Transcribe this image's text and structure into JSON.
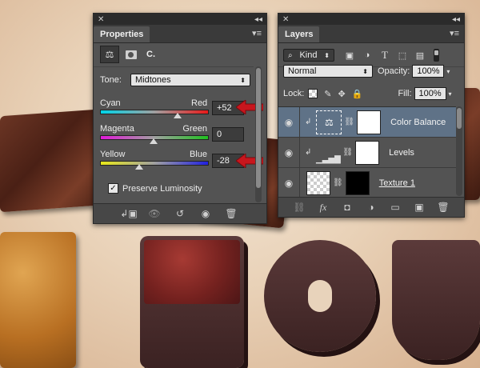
{
  "properties": {
    "tab_title": "Properties",
    "adjustment_short": "C.",
    "tone_label": "Tone:",
    "tone_value": "Midtones",
    "sliders": [
      {
        "left_label": "Cyan",
        "right_label": "Red",
        "value": "+52"
      },
      {
        "left_label": "Magenta",
        "right_label": "Green",
        "value": "0"
      },
      {
        "left_label": "Yellow",
        "right_label": "Blue",
        "value": "-28"
      }
    ],
    "preserve_luminosity_label": "Preserve Luminosity",
    "preserve_luminosity_checked": true
  },
  "layers": {
    "tab_title": "Layers",
    "filter_kind": "Kind",
    "blend_mode": "Normal",
    "opacity_label": "Opacity:",
    "opacity_value": "100%",
    "lock_label": "Lock:",
    "fill_label": "Fill:",
    "fill_value": "100%",
    "items": [
      {
        "name": "Color Balance",
        "selected": true
      },
      {
        "name": "Levels",
        "selected": false
      },
      {
        "name": "Texture 1",
        "selected": false
      }
    ],
    "footer_fx": "fx"
  },
  "colors": {
    "panel_bg": "#535353",
    "selected_row": "#5f7287",
    "arrow_red": "#c8161d"
  }
}
